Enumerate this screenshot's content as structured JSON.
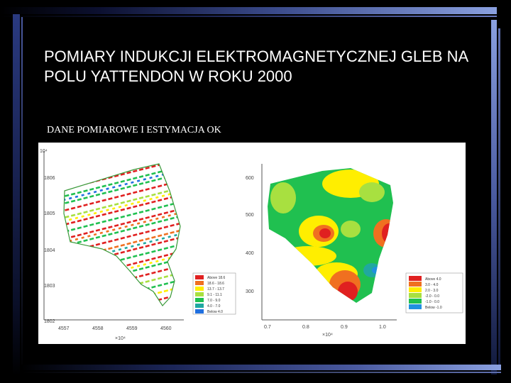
{
  "slide": {
    "title": "POMIARY INDUKCJI ELEKTROMAGNETYCZNEJ GLEB NA POLU YATTENDON W ROKU 2000",
    "subtitle": "DANE POMIAROWE I ESTYMACJA OK"
  },
  "left_map": {
    "y_exponent": "10⁴",
    "y_ticks": [
      "1806",
      "1805",
      "1804",
      "1803",
      "1802"
    ],
    "x_ticks": [
      "4557",
      "4558",
      "4559",
      "4560"
    ],
    "x_exponent": "×10⁴",
    "legend": [
      {
        "label": "Above 18.6",
        "color": "#e02020"
      },
      {
        "label": "18.6 - 18.6",
        "color": "#f07020"
      },
      {
        "label": "13.7 - 13.7",
        "color": "#ffee00"
      },
      {
        "label": "9.1 - 11.1",
        "color": "#a8e040"
      },
      {
        "label": "7.0 - 9.0",
        "color": "#20c050"
      },
      {
        "label": "4.0 - 7.0",
        "color": "#20a8a0"
      },
      {
        "label": "Below 4.0",
        "color": "#2070e0"
      }
    ]
  },
  "right_map": {
    "y_ticks": [
      "600",
      "500",
      "400",
      "300"
    ],
    "x_ticks": [
      "0.7",
      "0.8",
      "0.9",
      "1.0"
    ],
    "x_exponent": "×10⁴",
    "legend": [
      {
        "label": "Above 4.0",
        "color": "#e02020"
      },
      {
        "label": "3.0 - 4.0",
        "color": "#f07020"
      },
      {
        "label": "2.0 - 3.0",
        "color": "#ffee00"
      },
      {
        "label": "-2.0 - 0.0",
        "color": "#a8e040"
      },
      {
        "label": "-1.0 - 0.0",
        "color": "#20c050"
      },
      {
        "label": "Below -1.0",
        "color": "#2090e0"
      }
    ]
  }
}
